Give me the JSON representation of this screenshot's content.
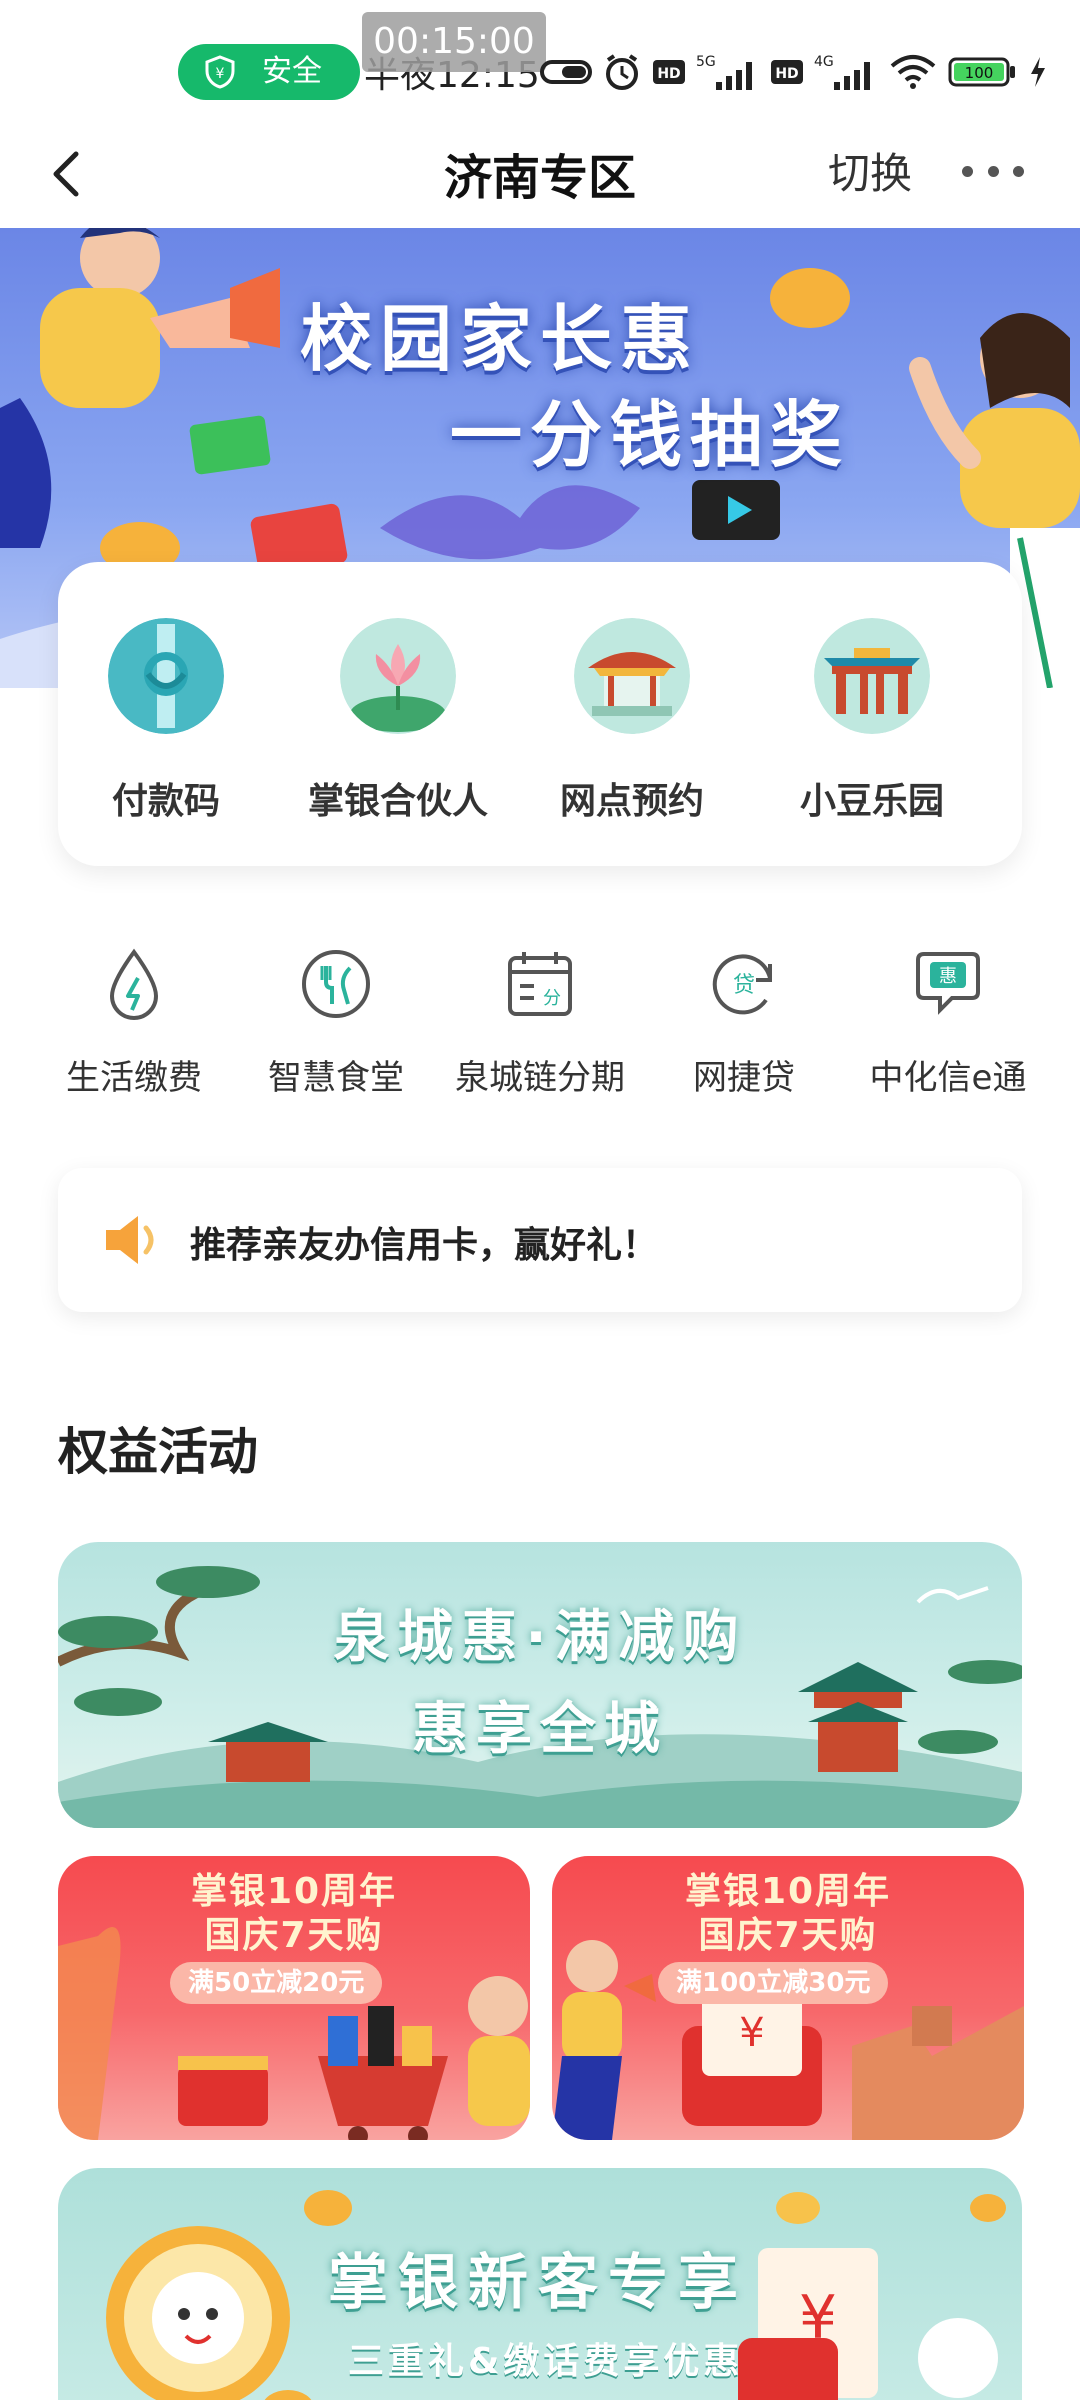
{
  "status_bar": {
    "recording_timer": "00:15:00",
    "safe_label": "安全",
    "time": "半夜12:15",
    "battery": "100",
    "network1": "5G",
    "network2": "4G"
  },
  "header": {
    "title": "济南专区",
    "switch_label": "切换"
  },
  "hero": {
    "line1": "校园家长惠",
    "line2": "一分钱抽奖"
  },
  "quick_actions": [
    {
      "label": "付款码",
      "icon": "payment-code-icon"
    },
    {
      "label": "掌银合伙人",
      "icon": "lotus-partner-icon"
    },
    {
      "label": "网点预约",
      "icon": "pavilion-icon"
    },
    {
      "label": "小豆乐园",
      "icon": "gate-icon"
    }
  ],
  "services": [
    {
      "label": "生活缴费",
      "icon": "utility-bill-icon"
    },
    {
      "label": "智慧食堂",
      "icon": "canteen-icon"
    },
    {
      "label": "泉城链分期",
      "icon": "installment-calendar-icon"
    },
    {
      "label": "网捷贷",
      "icon": "loan-icon"
    },
    {
      "label": "中化信e通",
      "icon": "chat-benefit-icon"
    }
  ],
  "service_icon_glyphs": {
    "calendar": "分",
    "loan": "贷",
    "chat": "惠"
  },
  "notice": {
    "text": "推荐亲友办信用卡，赢好礼！"
  },
  "section": {
    "title": "权益活动"
  },
  "banner_city": {
    "line1": "泉城惠·满减购",
    "line2": "惠享全城"
  },
  "banner_national_1": {
    "line1": "掌银10周年",
    "line2": "国庆7天购",
    "offer": "满50立减20元"
  },
  "banner_national_2": {
    "line1": "掌银10周年",
    "line2": "国庆7天购",
    "offer": "满100立减30元"
  },
  "banner_newcomer": {
    "line1": "掌银新客专享",
    "line2": "三重礼&缴话费享优惠"
  },
  "colors": {
    "brand_green": "#16b96b",
    "teal_icon": "#2bb39c",
    "red_banner": "#f64a4f",
    "hero_blue": "#6b86e6"
  }
}
